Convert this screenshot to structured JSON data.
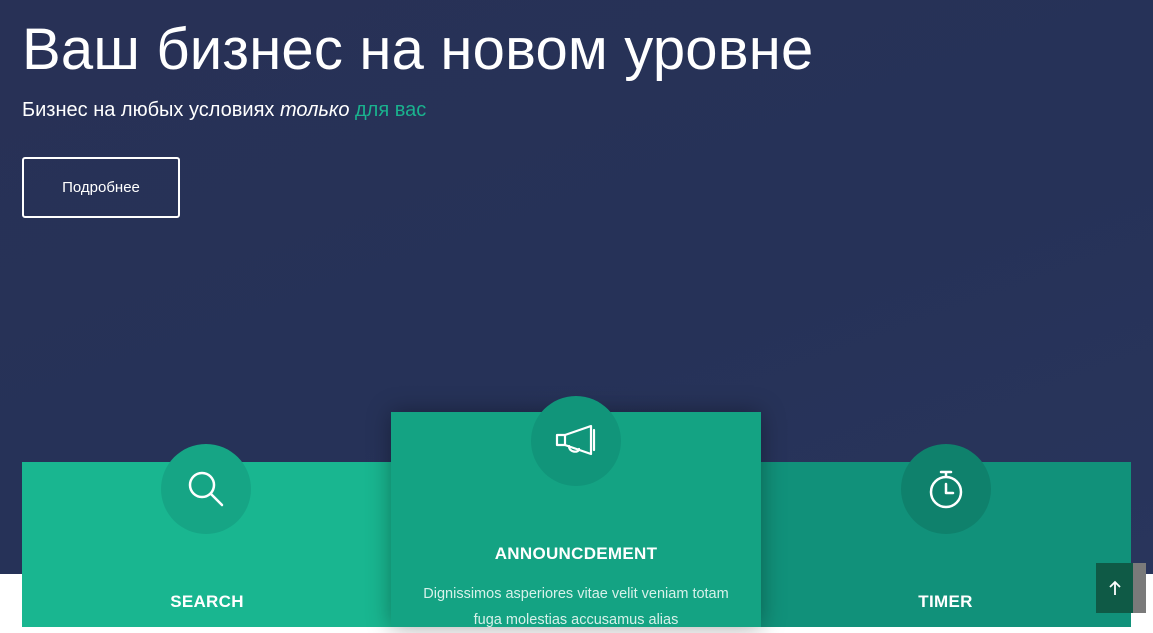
{
  "hero": {
    "title": "Ваш бизнес на новом уровне",
    "subtitle_part1": "Бизнес на любых условиях ",
    "subtitle_italic": "только",
    "subtitle_space": " ",
    "subtitle_accent": "для вас",
    "button_label": "Подробнее"
  },
  "cards": [
    {
      "title": "SEARCH",
      "icon": "search-icon"
    },
    {
      "title": "ANNOUNCDEMENT",
      "icon": "megaphone-icon",
      "text": "Dignissimos asperiores vitae velit veniam totam fuga molestias accusamus alias"
    },
    {
      "title": "TIMER",
      "icon": "stopwatch-icon"
    }
  ],
  "scroll_top": {
    "icon": "arrow-up-icon"
  },
  "colors": {
    "hero_bg": "#283156",
    "accent": "#1ab28e",
    "card_search": "#19b690",
    "card_announce": "#14a383",
    "card_timer": "#11917a",
    "scroll_top_bg": "#0f5a46"
  }
}
